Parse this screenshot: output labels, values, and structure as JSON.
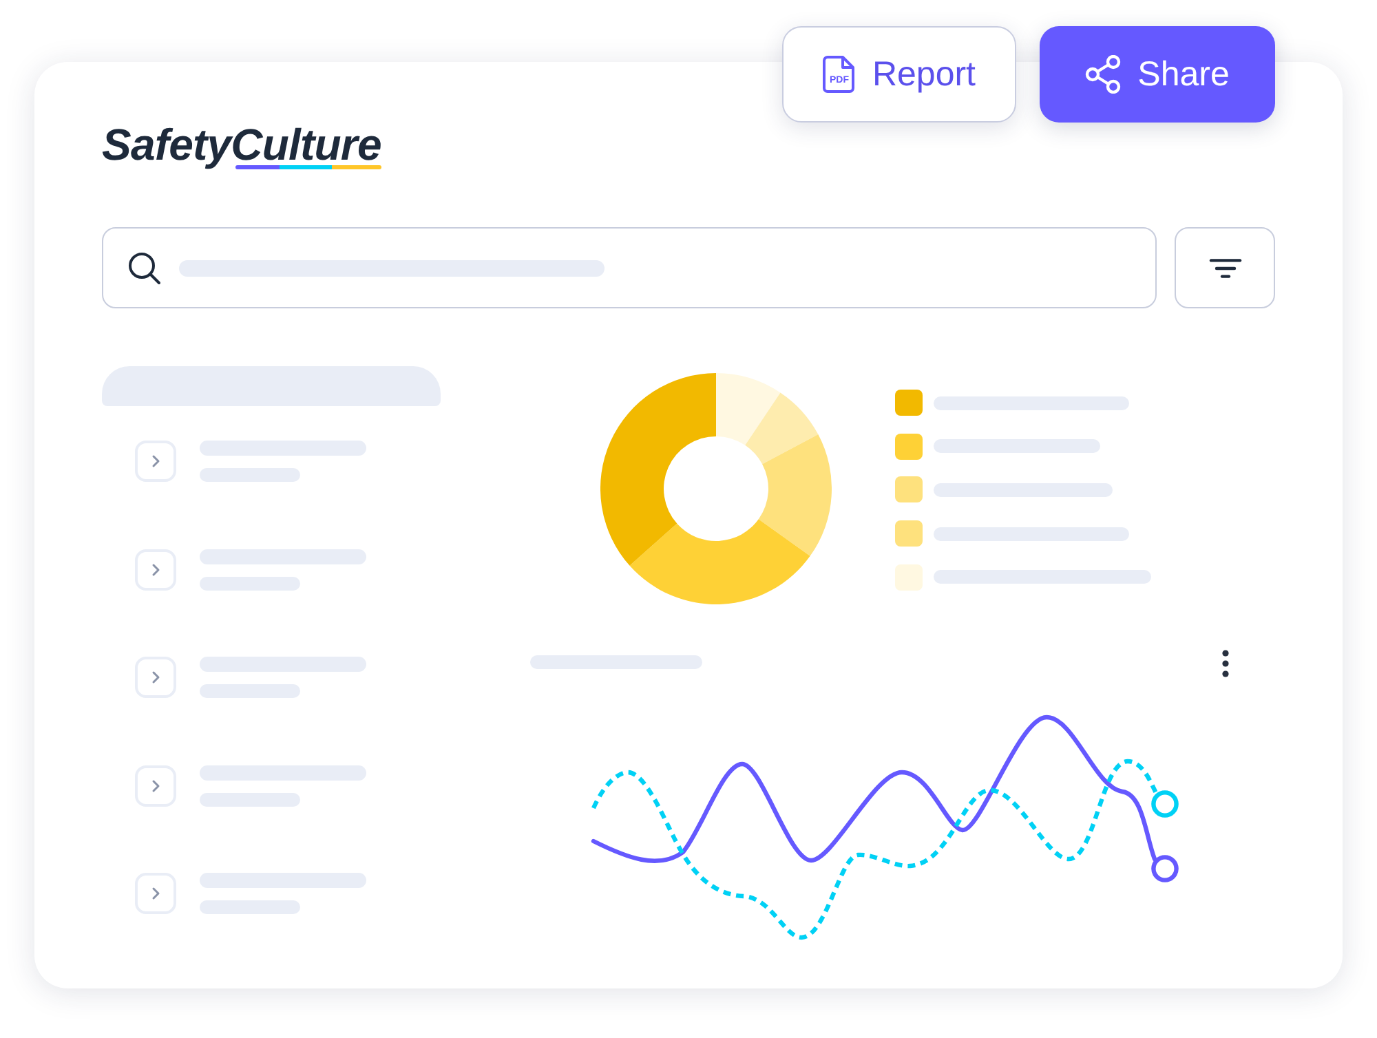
{
  "header": {
    "logo": "SafetyCulture",
    "actions": [
      {
        "kind": "outline",
        "icon_text": "PDF",
        "label": "Report"
      },
      {
        "kind": "filled",
        "label": "Share"
      }
    ]
  },
  "list": {
    "items": [
      {
        "expanded": false
      },
      {
        "expanded": false
      },
      {
        "expanded": false
      },
      {
        "expanded": false
      },
      {
        "expanded": false
      }
    ]
  },
  "donut": {
    "slices": [
      {
        "color": "#fff8e1"
      },
      {
        "color": "#feecae"
      },
      {
        "color": "#fee17d"
      },
      {
        "color": "#fed136"
      },
      {
        "color": "#f2b900"
      }
    ],
    "legend": [
      {
        "color": "#f2b900"
      },
      {
        "color": "#fed136"
      },
      {
        "color": "#fee17d"
      },
      {
        "color": "#fee17d"
      },
      {
        "color": "#fff8e1"
      }
    ]
  },
  "line_chart": {
    "series": [
      {
        "kind": "solid",
        "color": "#6559ff"
      },
      {
        "kind": "dashed",
        "color": "#00d1f5"
      }
    ]
  }
}
